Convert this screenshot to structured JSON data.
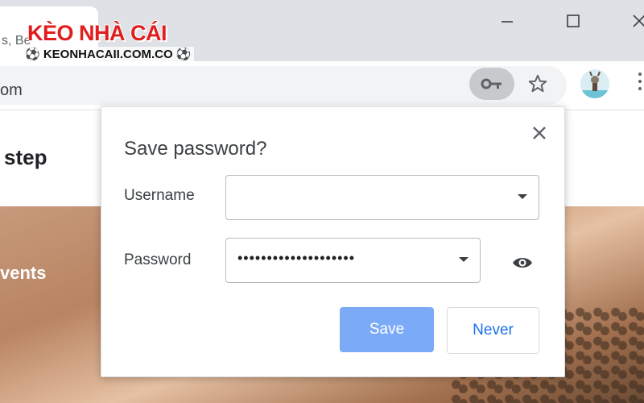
{
  "browser": {
    "tab_title": "s, Be",
    "url_fragment": "om",
    "window_controls": [
      "minimize",
      "maximize",
      "close"
    ],
    "toolbar_icons": [
      "key-icon",
      "star-icon",
      "avatar",
      "more-vert-icon"
    ]
  },
  "watermark": {
    "title": "KÈO NHÀ CÁI",
    "subtitle": "⚽ KEONHACAII.COM.CO ⚽"
  },
  "page": {
    "heading": "step",
    "hero_text": "vents"
  },
  "dialog": {
    "title": "Save password?",
    "username": {
      "label": "Username",
      "value": ""
    },
    "password": {
      "label": "Password",
      "value": "••••••••••••••••••••"
    },
    "save_label": "Save",
    "never_label": "Never",
    "colors": {
      "save": "#7baaf7",
      "never_text": "#1a73e8"
    }
  }
}
